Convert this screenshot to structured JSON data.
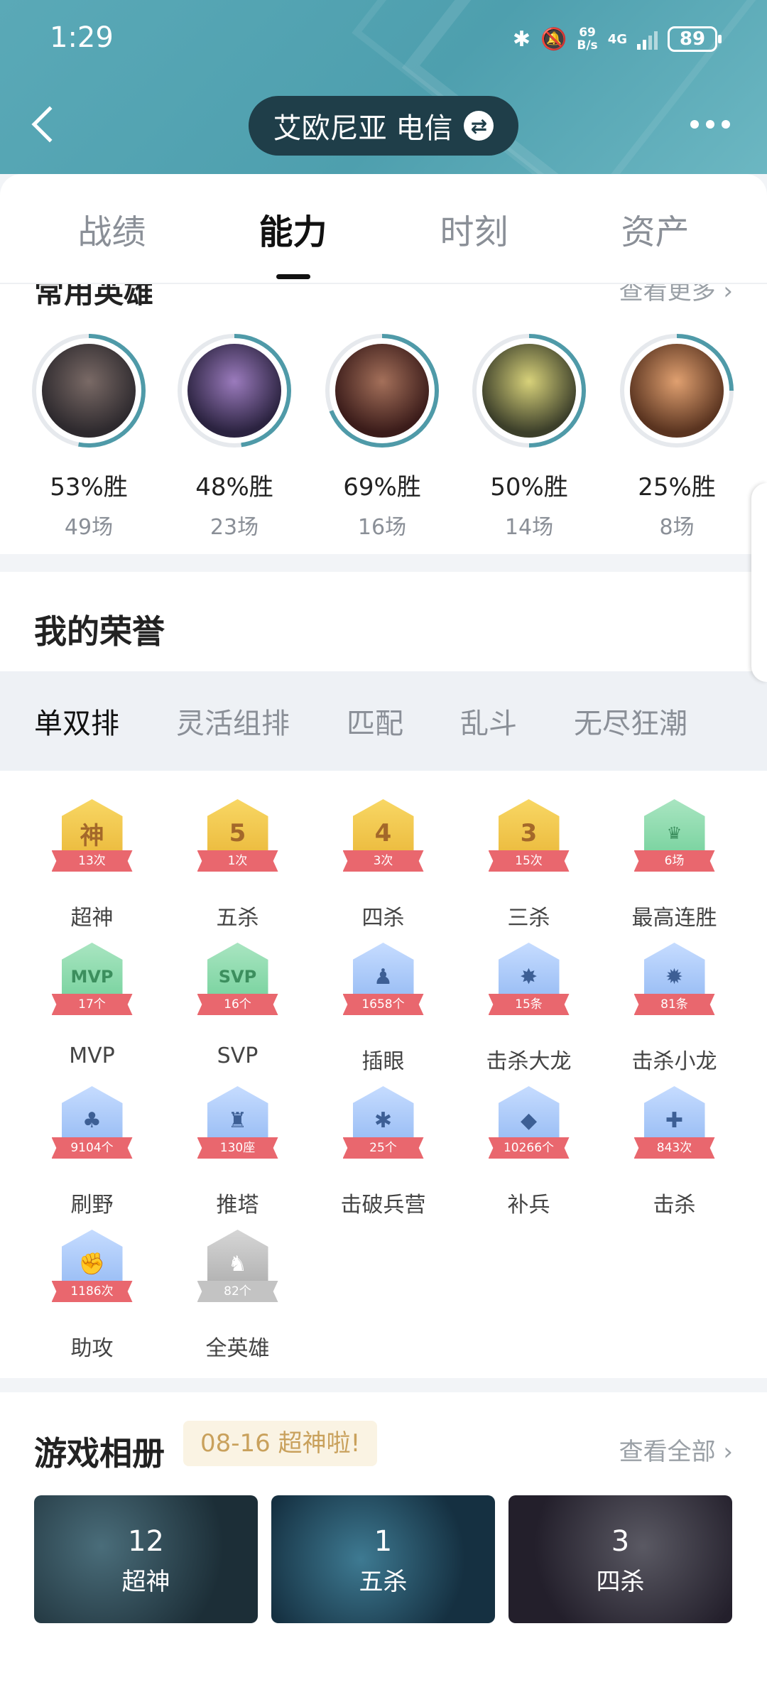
{
  "status_bar": {
    "time": "1:29",
    "net_speed_top": "69",
    "net_speed_bottom": "B/s",
    "network": "4G",
    "battery": "89"
  },
  "header": {
    "server": "艾欧尼亚 电信",
    "swap_glyph": "⇄"
  },
  "tabs": [
    {
      "label": "战绩"
    },
    {
      "label": "能力"
    },
    {
      "label": "时刻"
    },
    {
      "label": "资产"
    }
  ],
  "heroes": {
    "title": "常用英雄",
    "more": "查看更多 ›",
    "items": [
      {
        "rate": "53%胜",
        "games": "49场",
        "win_fraction": 0.53
      },
      {
        "rate": "48%胜",
        "games": "23场",
        "win_fraction": 0.48
      },
      {
        "rate": "69%胜",
        "games": "16场",
        "win_fraction": 0.69
      },
      {
        "rate": "50%胜",
        "games": "14场",
        "win_fraction": 0.5
      },
      {
        "rate": "25%胜",
        "games": "8场",
        "win_fraction": 0.25
      }
    ]
  },
  "honor": {
    "title": "我的荣誉",
    "modes": [
      "单双排",
      "灵活组排",
      "匹配",
      "乱斗",
      "无尽狂潮"
    ],
    "badges": [
      {
        "name": "超神",
        "count": "13次",
        "glyph": "神",
        "tier": "gold"
      },
      {
        "name": "五杀",
        "count": "1次",
        "glyph": "5",
        "tier": "gold"
      },
      {
        "name": "四杀",
        "count": "3次",
        "glyph": "4",
        "tier": "gold"
      },
      {
        "name": "三杀",
        "count": "15次",
        "glyph": "3",
        "tier": "gold"
      },
      {
        "name": "最高连胜",
        "count": "6场",
        "glyph": "♛",
        "tier": "green"
      },
      {
        "name": "MVP",
        "count": "17个",
        "glyph": "MVP",
        "tier": "green"
      },
      {
        "name": "SVP",
        "count": "16个",
        "glyph": "SVP",
        "tier": "green"
      },
      {
        "name": "插眼",
        "count": "1658个",
        "glyph": "♟",
        "tier": "blue"
      },
      {
        "name": "击杀大龙",
        "count": "15条",
        "glyph": "✸",
        "tier": "blue"
      },
      {
        "name": "击杀小龙",
        "count": "81条",
        "glyph": "✹",
        "tier": "blue"
      },
      {
        "name": "刷野",
        "count": "9104个",
        "glyph": "♣",
        "tier": "blue"
      },
      {
        "name": "推塔",
        "count": "130座",
        "glyph": "♜",
        "tier": "blue"
      },
      {
        "name": "击破兵营",
        "count": "25个",
        "glyph": "✱",
        "tier": "blue"
      },
      {
        "name": "补兵",
        "count": "10266个",
        "glyph": "◆",
        "tier": "blue"
      },
      {
        "name": "击杀",
        "count": "843次",
        "glyph": "✚",
        "tier": "blue"
      },
      {
        "name": "助攻",
        "count": "1186次",
        "glyph": "✊",
        "tier": "blue"
      },
      {
        "name": "全英雄",
        "count": "82个",
        "glyph": "♞",
        "tier": "gray"
      }
    ]
  },
  "album": {
    "title": "游戏相册",
    "tag": "08-16 超神啦!",
    "more": "查看全部 ›",
    "items": [
      {
        "count": "12",
        "label": "超神"
      },
      {
        "count": "1",
        "label": "五杀"
      },
      {
        "count": "3",
        "label": "四杀"
      }
    ]
  },
  "colors": {
    "header": "#5aa9b7",
    "pill": "#1f3e49",
    "ring": "#4f9aa8",
    "ribbon": "#e9676e",
    "gold": "#f0c44a",
    "green": "#7dd5a4",
    "blue": "#a8c6f5"
  }
}
